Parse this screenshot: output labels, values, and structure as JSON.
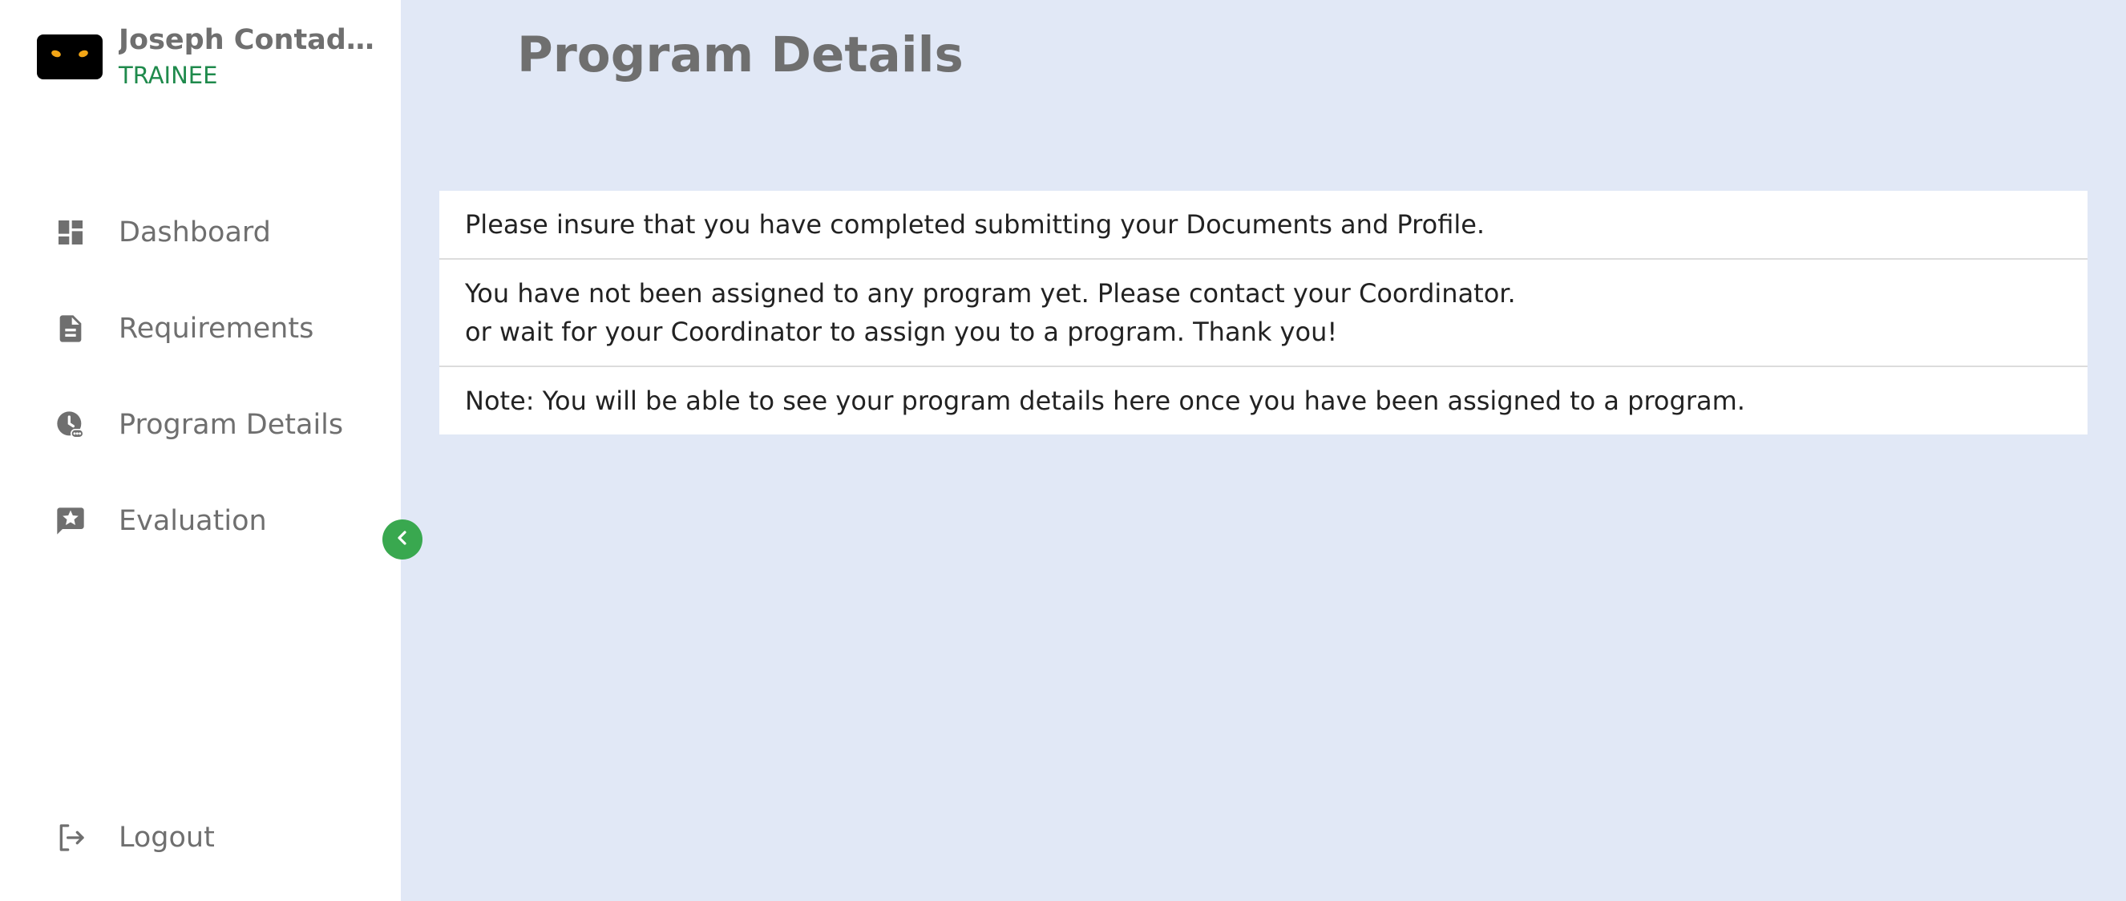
{
  "user": {
    "name": "Joseph Contad...",
    "role": "TRAINEE"
  },
  "sidebar": {
    "items": [
      {
        "label": "Dashboard",
        "icon": "dashboard-icon"
      },
      {
        "label": "Requirements",
        "icon": "document-icon"
      },
      {
        "label": "Program Details",
        "icon": "clock-settings-icon"
      },
      {
        "label": "Evaluation",
        "icon": "star-comment-icon"
      }
    ],
    "logout_label": "Logout",
    "collapse_icon": "chevron-left-icon"
  },
  "main": {
    "title": "Program Details",
    "messages": {
      "documents_notice": "Please insure that you have completed submitting your Documents and Profile.",
      "not_assigned_line1": "You have not been assigned to any program yet. Please contact your Coordinator.",
      "not_assigned_line2": "or wait for your Coordinator to assign you to a program. Thank you!",
      "note": "Note: You will be able to see your program details here once you have been assigned to a program."
    }
  },
  "colors": {
    "sidebar_bg": "#ffffff",
    "content_bg": "#e1e8f6",
    "accent_green": "#39a84f",
    "role_green": "#1f8a4c",
    "muted_text": "#6f6f6f"
  }
}
